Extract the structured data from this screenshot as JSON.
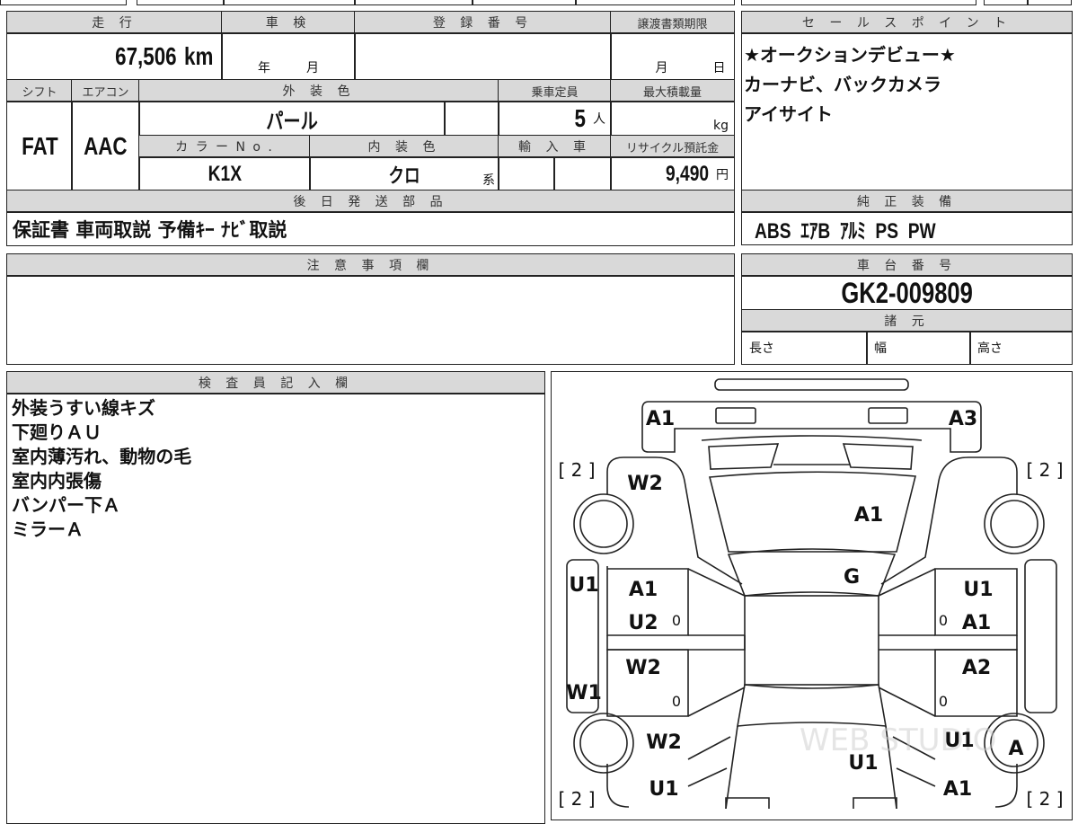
{
  "main_table": {
    "mileage_label": "走 行",
    "mileage_value": "67,506",
    "mileage_unit": "km",
    "shaken_label": "車 検",
    "shaken_year": "年",
    "shaken_month": "月",
    "registration_label": "登 録 番 号",
    "transfer_deadline_label": "譲渡書類期限",
    "transfer_month": "月",
    "transfer_day": "日",
    "shift_label": "シフト",
    "shift_value": "FAT",
    "aircon_label": "エアコン",
    "aircon_value": "AAC",
    "exterior_color_label": "外 装 色",
    "exterior_color_value": "パール",
    "capacity_label": "乗車定員",
    "capacity_value": "5",
    "capacity_unit": "人",
    "max_load_label": "最大積載量",
    "max_load_unit": "kg",
    "color_no_label": "カ ラ ー N o .",
    "color_no_value": "K1X",
    "interior_color_label": "内 装 色",
    "interior_color_value": "クロ",
    "interior_color_suffix": "系",
    "import_label": "輸 入 車",
    "recycle_label": "リサイクル預託金",
    "recycle_value": "9,490",
    "recycle_unit": "円",
    "later_parts_label": "後 日 発 送 部 品",
    "later_parts_value": "保証書 車両取説 予備ｷｰ ﾅﾋﾞ取説"
  },
  "sales_point": {
    "label": "セ ー ル ス ポ イ ン ト",
    "lines": [
      "★オークションデビュー★",
      "カーナビ、バックカメラ",
      "アイサイト"
    ],
    "equipment_label": "純 正 装 備",
    "equipment_value": "ABS  ｴｱB  ｱﾙﾐ  PS  PW"
  },
  "notes": {
    "label": "注 意 事 項 欄"
  },
  "chassis": {
    "label": "車 台 番 号",
    "value": "GK2-009809",
    "specs_label": "諸 元",
    "length_label": "長さ",
    "width_label": "幅",
    "height_label": "高さ"
  },
  "inspector": {
    "label": "検 査 員 記 入 欄",
    "lines": [
      "外装うすい線キズ",
      "下廻りＡＵ",
      "室内薄汚れ、動物の毛",
      "室内内張傷",
      "バンパー下Ａ",
      "ミラーＡ"
    ]
  },
  "diagram": {
    "marks": {
      "rear_left": "A1",
      "rear_right": "A3",
      "tire_rl_count": "[ 2 ]",
      "tire_rr_count": "[ 2 ]",
      "tire_fl_count": "[ 2 ]",
      "tire_fr_count": "[ 2 ]",
      "rear_quarter_left": "W2",
      "rear_glass": "A1",
      "rocker_left": "U1",
      "roof_front": "G",
      "rear_door_left_1": "A1",
      "rear_door_left_2": "U2",
      "rear_door_right_1": "U1",
      "rear_door_right_2": "A1",
      "front_door_left": "W2",
      "front_door_right": "A2",
      "rocker_left_lower": "W1",
      "fender_left": "W2",
      "fender_right": "U1",
      "tire_fr": "A",
      "hood": "U1",
      "front_left": "U1",
      "front_right": "A1",
      "zero": "0"
    },
    "watermark": "WEB STUDIO"
  }
}
